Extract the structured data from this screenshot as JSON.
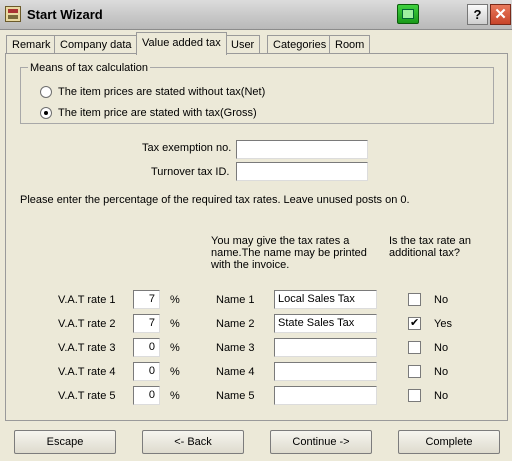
{
  "window": {
    "title": "Start Wizard",
    "help_label": "?",
    "close_label": "✕"
  },
  "tabs": [
    {
      "label": "Remark"
    },
    {
      "label": "Company data"
    },
    {
      "label": "Value added tax"
    },
    {
      "label": "User"
    },
    {
      "label": "Categories"
    },
    {
      "label": "Room"
    }
  ],
  "active_tab": "Value added tax",
  "tax_calc": {
    "group_title": "Means of tax calculation",
    "options": [
      {
        "label": "The item prices are stated without tax(Net)",
        "selected": false
      },
      {
        "label": "The item price are stated with tax(Gross)",
        "selected": true
      }
    ]
  },
  "fields": {
    "exemption_label": "Tax exemption no.",
    "exemption_value": "",
    "turnover_label": "Turnover tax ID.",
    "turnover_value": ""
  },
  "instructions": "Please enter the percentage of the required tax rates. Leave unused posts on 0.",
  "headers": {
    "name_hint": "You may give the tax rates a name.The name may be printed with the invoice.",
    "additional_hint": "Is the tax rate an additional tax?"
  },
  "rates": [
    {
      "label": "V.A.T rate 1",
      "value": "7",
      "unit": "%",
      "name_label": "Name 1",
      "name": "Local Sales Tax",
      "additional": false,
      "additional_label": "No"
    },
    {
      "label": "V.A.T rate 2",
      "value": "7",
      "unit": "%",
      "name_label": "Name 2",
      "name": "State Sales Tax",
      "additional": true,
      "additional_label": "Yes"
    },
    {
      "label": "V.A.T rate 3",
      "value": "0",
      "unit": "%",
      "name_label": "Name 3",
      "name": "",
      "additional": false,
      "additional_label": "No"
    },
    {
      "label": "V.A.T rate 4",
      "value": "0",
      "unit": "%",
      "name_label": "Name 4",
      "name": "",
      "additional": false,
      "additional_label": "No"
    },
    {
      "label": "V.A.T rate 5",
      "value": "0",
      "unit": "%",
      "name_label": "Name 5",
      "name": "",
      "additional": false,
      "additional_label": "No"
    }
  ],
  "buttons": {
    "escape": "Escape",
    "back": "<- Back",
    "continue": "Continue ->",
    "complete": "Complete"
  }
}
